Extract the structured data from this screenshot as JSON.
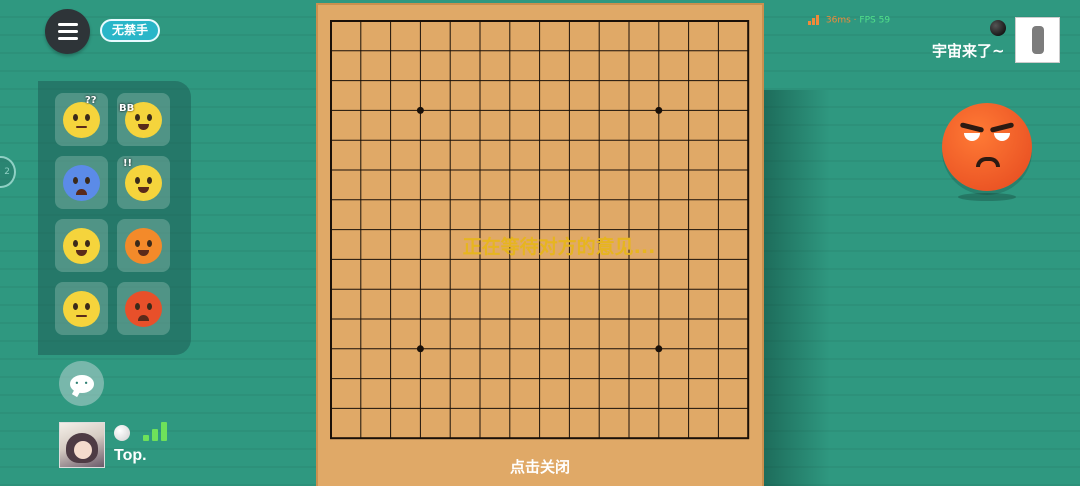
{
  "header": {
    "rule_badge": "无禁手"
  },
  "emoji_panel": {
    "items": [
      {
        "icon": "confused-face-icon",
        "color": "#f5d43c",
        "mark": "??"
      },
      {
        "icon": "shy-face-icon",
        "color": "#f5d43c",
        "mark": "BB"
      },
      {
        "icon": "sad-blue-face-icon",
        "color": "#5b8be8",
        "mark": ""
      },
      {
        "icon": "angry-yellow-face-icon",
        "color": "#f5d43c",
        "mark": "!!"
      },
      {
        "icon": "thumbs-up-face-icon",
        "color": "#f5d43c",
        "mark": ""
      },
      {
        "icon": "crying-orange-face-icon",
        "color": "#f38a2a",
        "mark": ""
      },
      {
        "icon": "smile-face-icon",
        "color": "#f5d43c",
        "mark": ""
      },
      {
        "icon": "grumpy-red-face-icon",
        "color": "#e8502a",
        "mark": ""
      }
    ]
  },
  "self_player": {
    "name": "Top.",
    "stone": "white",
    "signal_level": 3
  },
  "opponent": {
    "name": "宇宙来了~",
    "stone": "black",
    "emoji": "grumpy-red-face-icon"
  },
  "net_stats": {
    "ping": "36ms",
    "separator": "·",
    "fps": "FPS 59"
  },
  "board": {
    "size": 15,
    "star_points": [
      [
        3,
        3
      ],
      [
        3,
        11
      ],
      [
        11,
        3
      ],
      [
        11,
        11
      ]
    ],
    "stones": [],
    "wood_color": "#e0a967",
    "line_color": "#1a1008"
  },
  "overlay": {
    "waiting_message": "正在等待对方的意见...",
    "close_hint": "点击关闭"
  },
  "left_tab": {
    "label": "2"
  },
  "colors": {
    "background": "#2f9880",
    "accent_badge": "#29b6c8",
    "signal_green": "#6ee15a",
    "ping_orange": "#f08a3a",
    "fps_green": "#52e08a",
    "waiting_text": "#e7b51f"
  }
}
